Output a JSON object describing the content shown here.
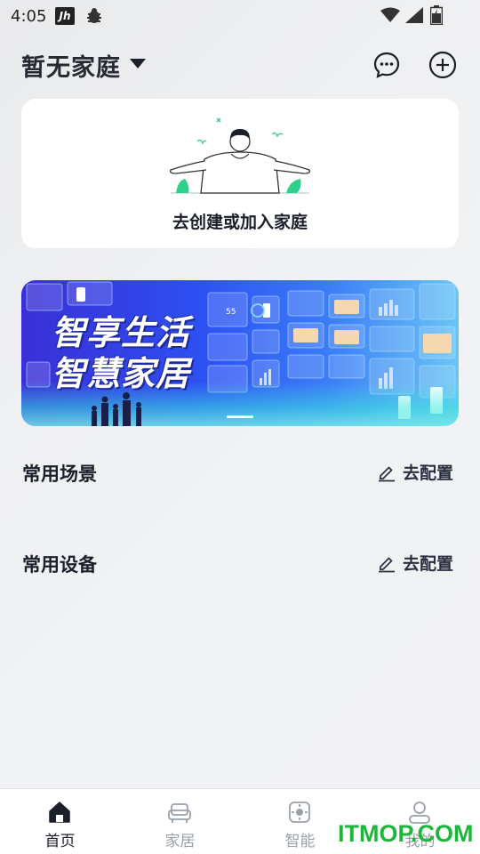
{
  "status_bar": {
    "time": "4:05",
    "app_icon_text": "Jh"
  },
  "header": {
    "title": "暂无家庭"
  },
  "family_card": {
    "cta": "去创建或加入家庭"
  },
  "banner": {
    "line1": "智享生活",
    "line2": "智慧家居"
  },
  "sections": [
    {
      "title": "常用场景",
      "action": "去配置"
    },
    {
      "title": "常用设备",
      "action": "去配置"
    }
  ],
  "bottom_nav": [
    {
      "label": "首页",
      "icon": "home-icon",
      "active": true
    },
    {
      "label": "家居",
      "icon": "sofa-icon",
      "active": false
    },
    {
      "label": "智能",
      "icon": "smart-icon",
      "active": false
    },
    {
      "label": "我的",
      "icon": "profile-icon",
      "active": false
    }
  ],
  "watermark": "ITMOP.COM",
  "colors": {
    "accent": "#1b1f2a",
    "inactive": "#9aa0aa",
    "watermark": "#1db53a",
    "card": "#ffffff"
  }
}
